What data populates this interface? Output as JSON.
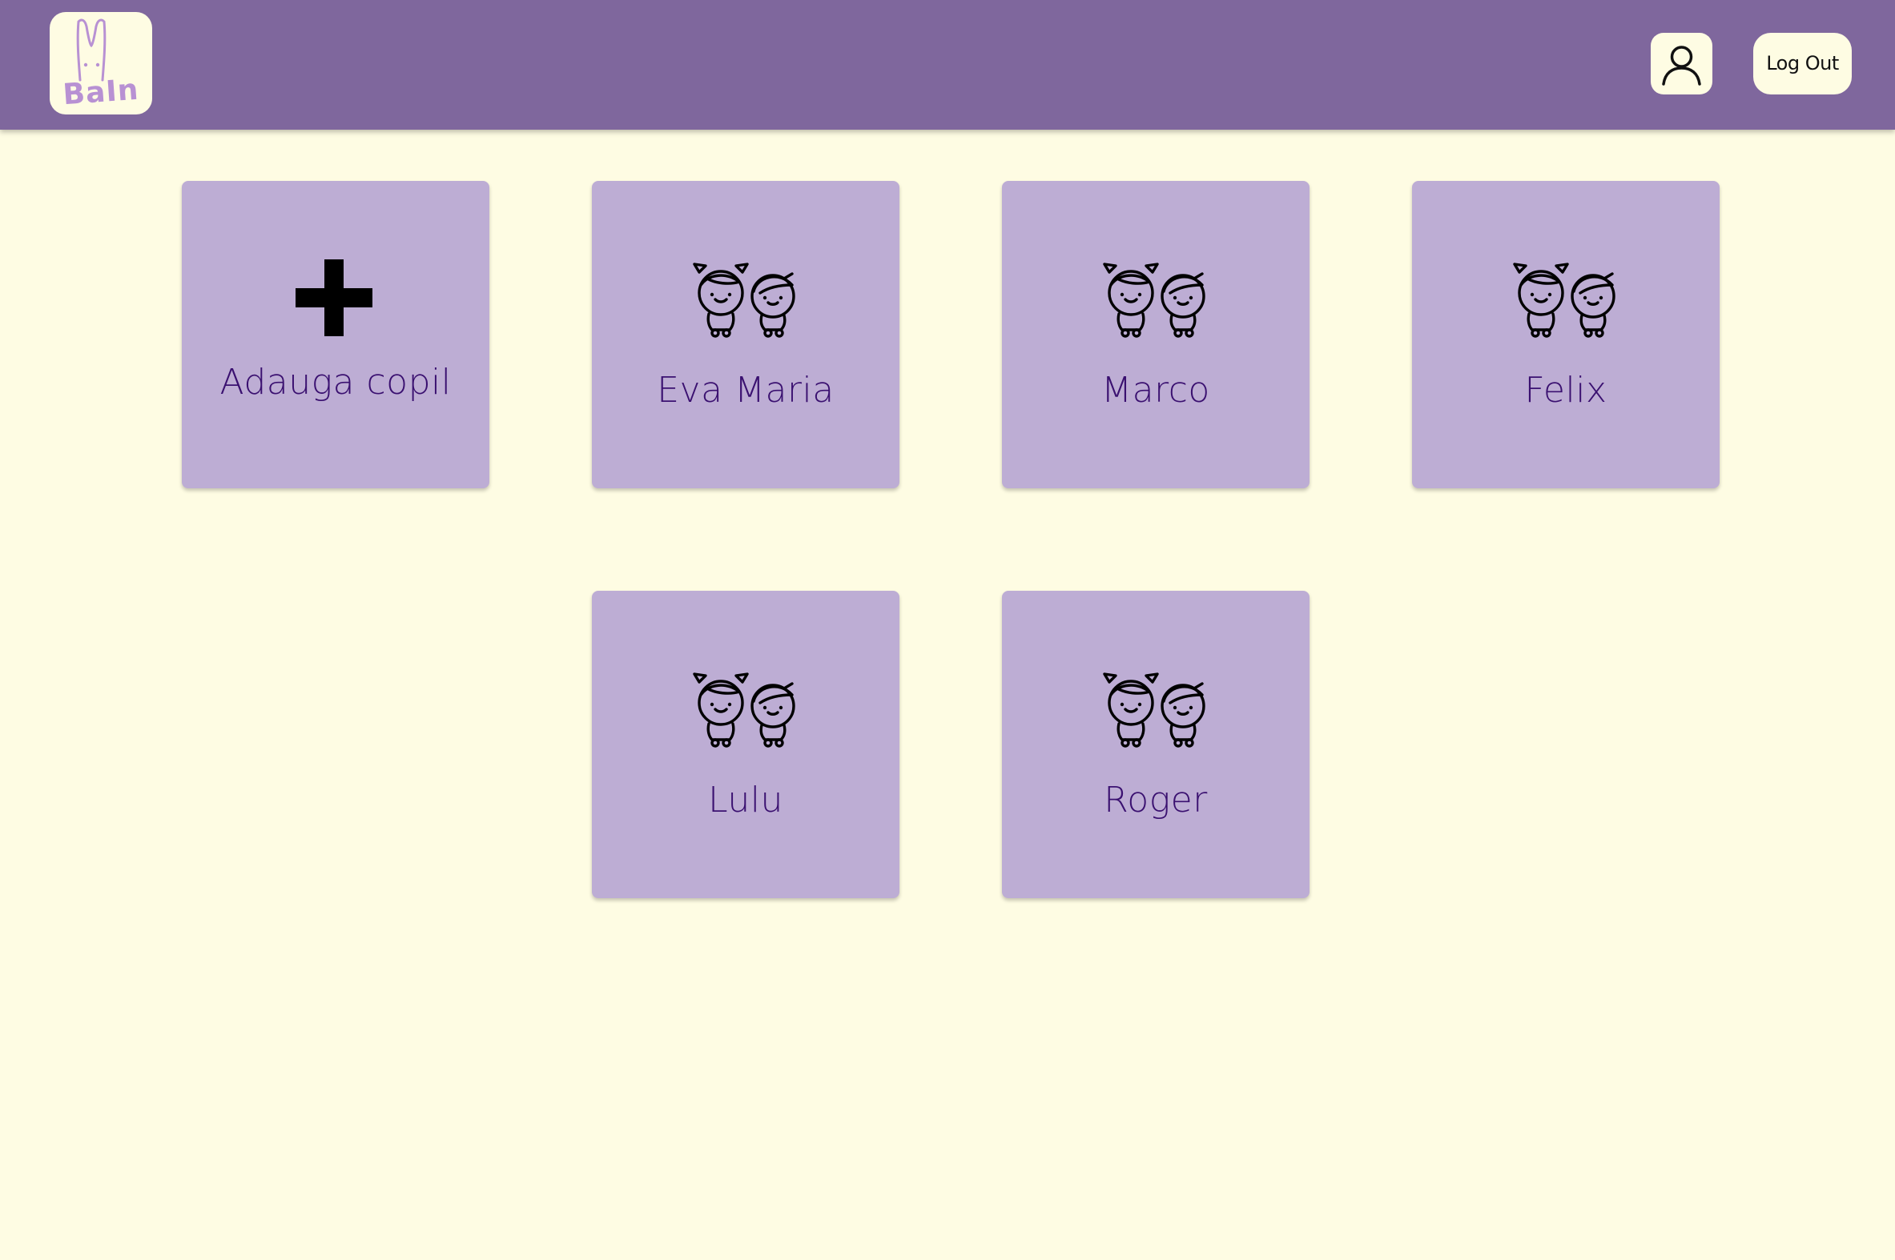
{
  "header": {
    "logo_text": "BaIn",
    "profile_icon": "user-outline-icon",
    "logout_label": "Log Out"
  },
  "add_card": {
    "icon": "plus-icon",
    "label": "Adauga copil"
  },
  "children": [
    {
      "name": "Eva Maria",
      "icon": "children-icon"
    },
    {
      "name": "Marco",
      "icon": "children-icon"
    },
    {
      "name": "Felix",
      "icon": "children-icon"
    },
    {
      "name": "Lulu",
      "icon": "children-icon"
    },
    {
      "name": "Roger",
      "icon": "children-icon"
    }
  ],
  "colors": {
    "header_bg": "#7f679d",
    "page_bg": "#fefce3",
    "card_bg": "#bdadd4",
    "label_text": "#3a1070",
    "logo_accent": "#b891d3"
  }
}
